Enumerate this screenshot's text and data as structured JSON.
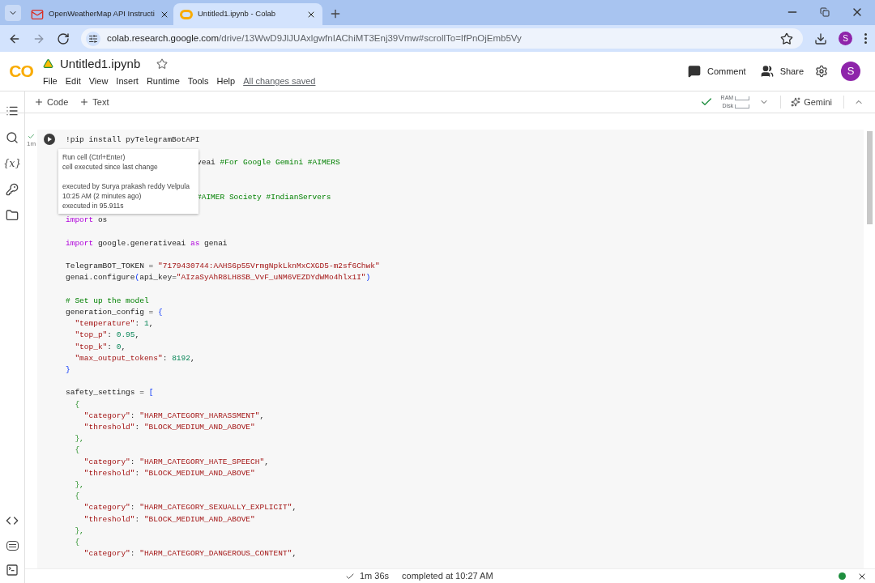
{
  "browser": {
    "tabs": [
      {
        "title": "OpenWeatherMap API Instructi",
        "selected": false
      },
      {
        "title": "Untitled1.ipynb - Colab",
        "selected": true
      }
    ],
    "url_host": "colab.research.google.com",
    "url_path": "/drive/13WwD9JlJUAxlgwfnIAChiMT3Enj39Vmw#scrollTo=IfPnOjEmb5Vy",
    "profile_initial": "S"
  },
  "header": {
    "logo": "CO",
    "title": "Untitled1.ipynb",
    "menu": [
      "File",
      "Edit",
      "View",
      "Insert",
      "Runtime",
      "Tools",
      "Help"
    ],
    "save_status": "All changes saved",
    "comment": "Comment",
    "share": "Share",
    "avatar_initial": "S"
  },
  "toolbar": {
    "add": [
      "Code",
      "Text"
    ],
    "ram_label": "RAM",
    "disk_label": "Disk",
    "gemini": "Gemini"
  },
  "sidebar": {
    "variables_label": "{x}"
  },
  "cell": {
    "status_time": "1m",
    "tooltip": [
      [
        "Run cell (Ctrl+Enter)",
        "cell executed since last change"
      ],
      [
        "executed by Surya prakash reddy Velpula",
        "10:25 AM (2 minutes ago)",
        "executed in 95.911s"
      ]
    ],
    "lines": [
      {
        "kind": "code",
        "tokens": [
          {
            "text": "!pip install pyTelegramBotAPI",
            "kind": "plain"
          }
        ]
      },
      {
        "kind": "blank"
      },
      {
        "kind": "covered",
        "tokens": [
          {
            "text": "veai ",
            "kind": "plain"
          },
          {
            "text": "#For Google Gemini #AIMERS",
            "kind": "comment"
          }
        ]
      },
      {
        "kind": "blank"
      },
      {
        "kind": "blank"
      },
      {
        "kind": "covered",
        "tokens": [
          {
            "text": "#AIMER Society #IndianServers",
            "kind": "comment"
          }
        ]
      },
      {
        "kind": "blank"
      },
      {
        "kind": "code",
        "tokens": [
          {
            "text": "import",
            "kind": "keyword"
          },
          {
            "text": " os",
            "kind": "plain"
          }
        ]
      },
      {
        "kind": "blank"
      },
      {
        "kind": "code",
        "tokens": [
          {
            "text": "import",
            "kind": "keyword"
          },
          {
            "text": " google.generativeai ",
            "kind": "plain"
          },
          {
            "text": "as",
            "kind": "keyword"
          },
          {
            "text": " genai",
            "kind": "plain"
          }
        ]
      },
      {
        "kind": "blank"
      },
      {
        "kind": "code",
        "tokens": [
          {
            "text": "TelegramBOT_TOKEN = ",
            "kind": "plain"
          },
          {
            "text": "\"7179430744:AAHS6p55VrmgNpkLknMxCXGD5-m2sf6Chwk\"",
            "kind": "string"
          }
        ]
      },
      {
        "kind": "code",
        "tokens": [
          {
            "text": "genai.configure",
            "kind": "plain"
          },
          {
            "text": "(",
            "kind": "bracket"
          },
          {
            "text": "api_key=",
            "kind": "plain"
          },
          {
            "text": "\"AIzaSyAhR8LH8SB_VvF_uNM6VEZDYdWMo4hlx1I\"",
            "kind": "string"
          },
          {
            "text": ")",
            "kind": "bracket"
          }
        ]
      },
      {
        "kind": "blank"
      },
      {
        "kind": "code",
        "tokens": [
          {
            "text": "# Set up the model",
            "kind": "comment"
          }
        ]
      },
      {
        "kind": "code",
        "tokens": [
          {
            "text": "generation_config = ",
            "kind": "plain"
          },
          {
            "text": "{",
            "kind": "bracket"
          }
        ]
      },
      {
        "kind": "code",
        "tokens": [
          {
            "text": "  \"temperature\"",
            "kind": "string"
          },
          {
            "text": ": ",
            "kind": "plain"
          },
          {
            "text": "1",
            "kind": "number"
          },
          {
            "text": ",",
            "kind": "plain"
          }
        ]
      },
      {
        "kind": "code",
        "tokens": [
          {
            "text": "  \"top_p\"",
            "kind": "string"
          },
          {
            "text": ": ",
            "kind": "plain"
          },
          {
            "text": "0.95",
            "kind": "number"
          },
          {
            "text": ",",
            "kind": "plain"
          }
        ]
      },
      {
        "kind": "code",
        "tokens": [
          {
            "text": "  \"top_k\"",
            "kind": "string"
          },
          {
            "text": ": ",
            "kind": "plain"
          },
          {
            "text": "0",
            "kind": "number"
          },
          {
            "text": ",",
            "kind": "plain"
          }
        ]
      },
      {
        "kind": "code",
        "tokens": [
          {
            "text": "  \"max_output_tokens\"",
            "kind": "string"
          },
          {
            "text": ": ",
            "kind": "plain"
          },
          {
            "text": "8192",
            "kind": "number"
          },
          {
            "text": ",",
            "kind": "plain"
          }
        ]
      },
      {
        "kind": "code",
        "tokens": [
          {
            "text": "}",
            "kind": "bracket"
          }
        ]
      },
      {
        "kind": "blank"
      },
      {
        "kind": "code",
        "tokens": [
          {
            "text": "safety_settings = ",
            "kind": "plain"
          },
          {
            "text": "[",
            "kind": "bracket"
          }
        ]
      },
      {
        "kind": "code",
        "tokens": [
          {
            "text": "  {",
            "kind": "inner_bracket"
          }
        ]
      },
      {
        "kind": "code",
        "tokens": [
          {
            "text": "    \"category\"",
            "kind": "string"
          },
          {
            "text": ": ",
            "kind": "plain"
          },
          {
            "text": "\"HARM_CATEGORY_HARASSMENT\"",
            "kind": "string"
          },
          {
            "text": ",",
            "kind": "plain"
          }
        ]
      },
      {
        "kind": "code",
        "tokens": [
          {
            "text": "    \"threshold\"",
            "kind": "string"
          },
          {
            "text": ": ",
            "kind": "plain"
          },
          {
            "text": "\"BLOCK_MEDIUM_AND_ABOVE\"",
            "kind": "string"
          }
        ]
      },
      {
        "kind": "code",
        "tokens": [
          {
            "text": "  },",
            "kind": "inner_bracket"
          }
        ]
      },
      {
        "kind": "code",
        "tokens": [
          {
            "text": "  {",
            "kind": "inner_bracket"
          }
        ]
      },
      {
        "kind": "code",
        "tokens": [
          {
            "text": "    \"category\"",
            "kind": "string"
          },
          {
            "text": ": ",
            "kind": "plain"
          },
          {
            "text": "\"HARM_CATEGORY_HATE_SPEECH\"",
            "kind": "string"
          },
          {
            "text": ",",
            "kind": "plain"
          }
        ]
      },
      {
        "kind": "code",
        "tokens": [
          {
            "text": "    \"threshold\"",
            "kind": "string"
          },
          {
            "text": ": ",
            "kind": "plain"
          },
          {
            "text": "\"BLOCK_MEDIUM_AND_ABOVE\"",
            "kind": "string"
          }
        ]
      },
      {
        "kind": "code",
        "tokens": [
          {
            "text": "  },",
            "kind": "inner_bracket"
          }
        ]
      },
      {
        "kind": "code",
        "tokens": [
          {
            "text": "  {",
            "kind": "inner_bracket"
          }
        ]
      },
      {
        "kind": "code",
        "tokens": [
          {
            "text": "    \"category\"",
            "kind": "string"
          },
          {
            "text": ": ",
            "kind": "plain"
          },
          {
            "text": "\"HARM_CATEGORY_SEXUALLY_EXPLICIT\"",
            "kind": "string"
          },
          {
            "text": ",",
            "kind": "plain"
          }
        ]
      },
      {
        "kind": "code",
        "tokens": [
          {
            "text": "    \"threshold\"",
            "kind": "string"
          },
          {
            "text": ": ",
            "kind": "plain"
          },
          {
            "text": "\"BLOCK_MEDIUM_AND_ABOVE\"",
            "kind": "string"
          }
        ]
      },
      {
        "kind": "code",
        "tokens": [
          {
            "text": "  },",
            "kind": "inner_bracket"
          }
        ]
      },
      {
        "kind": "code",
        "tokens": [
          {
            "text": "  {",
            "kind": "inner_bracket"
          }
        ]
      },
      {
        "kind": "code",
        "tokens": [
          {
            "text": "    \"category\"",
            "kind": "string"
          },
          {
            "text": ": ",
            "kind": "plain"
          },
          {
            "text": "\"HARM_CATEGORY_DANGEROUS_CONTENT\"",
            "kind": "string"
          },
          {
            "text": ",",
            "kind": "plain"
          }
        ]
      }
    ]
  },
  "status_bar": {
    "duration": "1m 36s",
    "completed": "completed at 10:27 AM",
    "connected": true
  }
}
